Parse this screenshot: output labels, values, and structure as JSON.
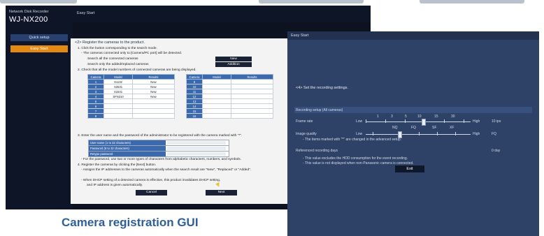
{
  "left_window": {
    "brand_small": "Network Disk Recorder",
    "brand_model": "WJ-NX200",
    "top_title": "Easy Start",
    "sidebar": {
      "quick_setup": "Quick setup",
      "easy_start": "Easy Start"
    },
    "step_heading": "<2> Register the cameras to the product.",
    "step1": "1. Click the button corresponding to the search mode.",
    "step1_note": "- The cameras connected only to [Camera/PC port] will be detected.",
    "search_all_label": "Search all the connected cameras",
    "search_all_button": "New",
    "search_added_label": "Search only the added/replaced cameras",
    "search_added_button": "Addition",
    "step2": "2. Check that all the model numbers of connected cameras are being displayed.",
    "table_headers": [
      "Camera",
      "Model",
      "Results"
    ],
    "table_left": [
      {
        "cam": "1",
        "model": "S1132",
        "result": "New"
      },
      {
        "cam": "2",
        "model": "S2531",
        "result": "New"
      },
      {
        "cam": "3",
        "model": "S1531",
        "result": "New"
      },
      {
        "cam": "4",
        "model": "SFN310",
        "result": "New"
      },
      {
        "cam": "5",
        "model": "",
        "result": ""
      },
      {
        "cam": "6",
        "model": "",
        "result": ""
      },
      {
        "cam": "7",
        "model": "",
        "result": ""
      },
      {
        "cam": "8",
        "model": "",
        "result": ""
      }
    ],
    "table_right": [
      {
        "cam": "9",
        "model": "",
        "result": ""
      },
      {
        "cam": "10",
        "model": "",
        "result": ""
      },
      {
        "cam": "11",
        "model": "",
        "result": ""
      },
      {
        "cam": "12",
        "model": "",
        "result": ""
      },
      {
        "cam": "13",
        "model": "",
        "result": ""
      },
      {
        "cam": "14",
        "model": "",
        "result": ""
      },
      {
        "cam": "15",
        "model": "",
        "result": ""
      },
      {
        "cam": "16",
        "model": "",
        "result": ""
      }
    ],
    "step3": "3. Enter the user name and the password of the administrator to be registered with the camera marked with \"*\".",
    "user_name_label": "User name (1 to 32 characters)",
    "password_label": "Password (8 to 32 characters)",
    "retype_label": "Retype password",
    "password_note": "- For the password, use two or more types of characters from alphabetic characters, numbers, and symbols.",
    "step4": "4. Register the cameras by clicking the [Next] button.",
    "step4_note": "- Assigns the IP addresses to the cameras automatically when the search result are \"New\", \"Replaced\" or \"Added\".",
    "dhcp_note1": "- When DHCP setting of a detected camera is effective, this product invalidates DHCP setting,",
    "dhcp_note2": "and IP address is given automatically.",
    "cancel_button": "Cancel",
    "next_button": "Next"
  },
  "caption": "Camera registration GUI",
  "right_window": {
    "title": "Easy Start",
    "step_heading": "<4> Set the recording settings.",
    "section_heading": "Recording setup (All cameras)",
    "frame_rate": {
      "label": "Frame rate",
      "ticks": [
        "1",
        "3",
        "5",
        "10",
        "15",
        "30"
      ],
      "low": "Low",
      "high": "High",
      "value": "10 ips",
      "level": 0.55
    },
    "image_quality": {
      "label": "Image quality",
      "ticks": [
        "NQ",
        "FQ",
        "SF",
        "XF"
      ],
      "low": "Low",
      "high": "High",
      "value": "FQ",
      "level": 0.33
    },
    "advanced_note": "- The items marked with \"*\" are changed in the advanced setup.",
    "ref_days_label": "Referenced recording days",
    "ref_days_value": "0 day",
    "hdd_note": "- This value excludes the HDD consumption for the event recording.",
    "panasonic_note": "- This value is not displayed when non-Panasonic camera is connected.",
    "exit_button": "Exit"
  }
}
